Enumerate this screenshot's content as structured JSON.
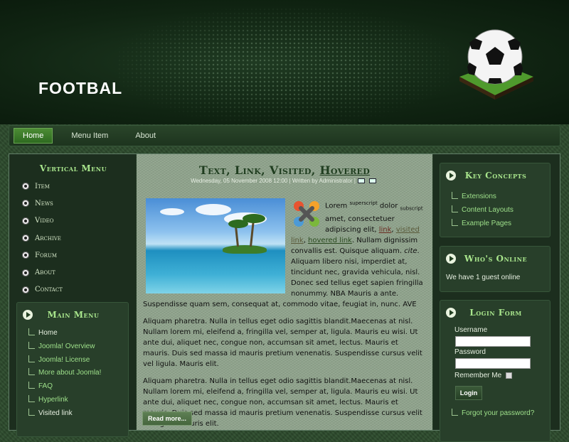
{
  "site": {
    "title": "FOOTBAL"
  },
  "topnav": {
    "items": [
      {
        "label": "Home",
        "active": true
      },
      {
        "label": "Menu Item",
        "active": false
      },
      {
        "label": "About",
        "active": false
      }
    ]
  },
  "vertical_menu": {
    "title": "Vertical Menu",
    "items": [
      "Item",
      "News",
      "Video",
      "Archive",
      "Forum",
      "About",
      "Contact"
    ]
  },
  "main_menu": {
    "title": "Main Menu",
    "items": [
      "Home",
      "Joomla! Overview",
      "Joomla! License",
      "More about Joomla!",
      "FAQ",
      "Hyperlink",
      "Visited link"
    ]
  },
  "article": {
    "title_parts": [
      "Text",
      "Link",
      "Visited",
      "Hovered"
    ],
    "title_sep": ", ",
    "meta": "Wednesday, 05 November 2008 12:00 | Written by Administrator |",
    "p1": {
      "lorem": "Lorem ",
      "sup": "superscript",
      "dolor": " dolor ",
      "sub": "subscript",
      "after_sub": " amet, consectetuer adipiscing elit, ",
      "link": "link",
      "visited": "visited link",
      "hovered": "hovered link",
      "rest1": ". Nullam dignissim convallis est. Quisque aliquam. ",
      "cite": "cite",
      "rest2": ". Aliquam libero nisi, imperdiet at, tincidunt nec, gravida vehicula, nisl. Donec sed tellus eget sapien fringilla nonummy. NBA Mauris a ante. Suspendisse quam sem, consequat at, commodo vitae, feugiat in, nunc. AVE"
    },
    "p2": "Aliquam pharetra. Nulla in tellus eget odio sagittis blandit.Maecenas at nisl. Nullam lorem mi, eleifend a, fringilla vel, semper at, ligula. Mauris eu wisi. Ut ante dui, aliquet nec, congue non, accumsan sit amet, lectus. Mauris et mauris. Duis sed massa id mauris pretium venenatis. Suspendisse cursus velit vel ligula. Mauris elit.",
    "p3": "Aliquam pharetra. Nulla in tellus eget odio sagittis blandit.Maecenas at nisl. Nullam lorem mi, eleifend a, fringilla vel, semper at, ligula. Mauris eu wisi. Ut ante dui, aliquet nec, congue non, accumsan sit amet, lectus. Mauris et mauris. Duis sed massa id mauris pretium venenatis. Suspendisse cursus velit vel ligula. Mauris elit.",
    "read_more": "Read more..."
  },
  "key_concepts": {
    "title": "Key Concepts",
    "items": [
      "Extensions",
      "Content Layouts",
      "Example Pages"
    ]
  },
  "whos_online": {
    "title": "Who's Online",
    "text": "We have 1 guest online"
  },
  "login_form": {
    "title": "Login Form",
    "username_label": "Username",
    "password_label": "Password",
    "remember_label": "Remember Me",
    "login_button": "Login",
    "forgot": "Forgot your password?"
  },
  "colors": {
    "accent_green": "#a8e58c",
    "nav_active": "#4c8c35",
    "header_bg": "#102412"
  },
  "icons": [
    "soccer-ball-logo",
    "ball-bullet-icon",
    "play-circle-icon",
    "print-icon",
    "edit-icon",
    "joomla-logo"
  ]
}
